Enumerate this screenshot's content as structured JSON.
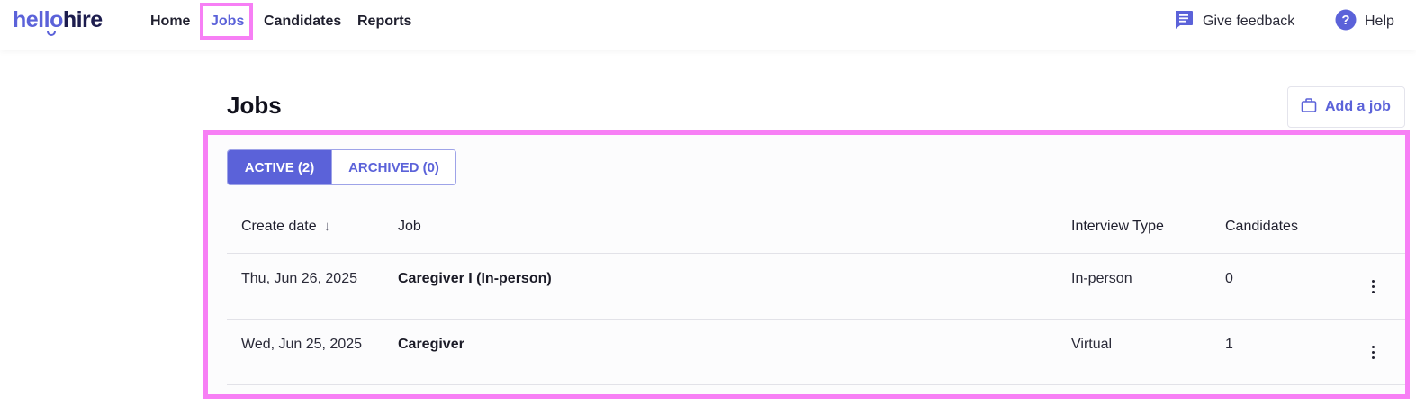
{
  "brand": {
    "logo_hello": "hello",
    "logo_hire": "hire"
  },
  "nav": {
    "home": "Home",
    "jobs": "Jobs",
    "candidates": "Candidates",
    "reports": "Reports",
    "active_item": "Jobs"
  },
  "header_actions": {
    "feedback_label": "Give feedback",
    "feedback_icon": "chat-bubble-icon",
    "help_label": "Help",
    "help_icon": "question-circle-icon"
  },
  "page": {
    "title": "Jobs",
    "add_job_label": "Add a job",
    "add_job_icon": "briefcase-icon"
  },
  "tabs": [
    {
      "label": "ACTIVE (2)",
      "selected": true
    },
    {
      "label": "ARCHIVED (0)",
      "selected": false
    }
  ],
  "table": {
    "columns": {
      "create_date": "Create date",
      "job": "Job",
      "interview_type": "Interview Type",
      "candidates": "Candidates"
    },
    "sort": {
      "column": "Create date",
      "direction": "descending",
      "icon": "arrow-down-icon"
    },
    "rows": [
      {
        "create_date": "Thu, Jun 26, 2025",
        "job": "Caregiver I (In-person)",
        "interview_type": "In-person",
        "candidates": "0"
      },
      {
        "create_date": "Wed, Jun 25, 2025",
        "job": "Caregiver",
        "interview_type": "Virtual",
        "candidates": "1"
      }
    ]
  },
  "colors": {
    "accent": "#5b62d9",
    "brand_dark": "#1c1c4e",
    "highlight": "#f77ff5"
  }
}
